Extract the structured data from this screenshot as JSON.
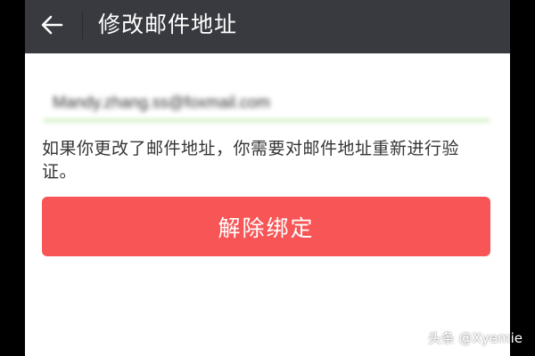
{
  "app_bar": {
    "title": "修改邮件地址",
    "back_icon": "arrow-left-icon"
  },
  "email_input": {
    "value": "Mandy.zhang.ss@foxmail.com",
    "focus_color": "#45c01a"
  },
  "hint_text": "如果你更改了邮件地址，你需要对邮件地址重新进行验证。",
  "unbind_button": {
    "label": "解除绑定",
    "color": "#f75556"
  },
  "watermark": "头条 @Xyemie",
  "colors": {
    "app_bar": "#393a3f",
    "background": "#ffffff",
    "outer": "#000000"
  }
}
